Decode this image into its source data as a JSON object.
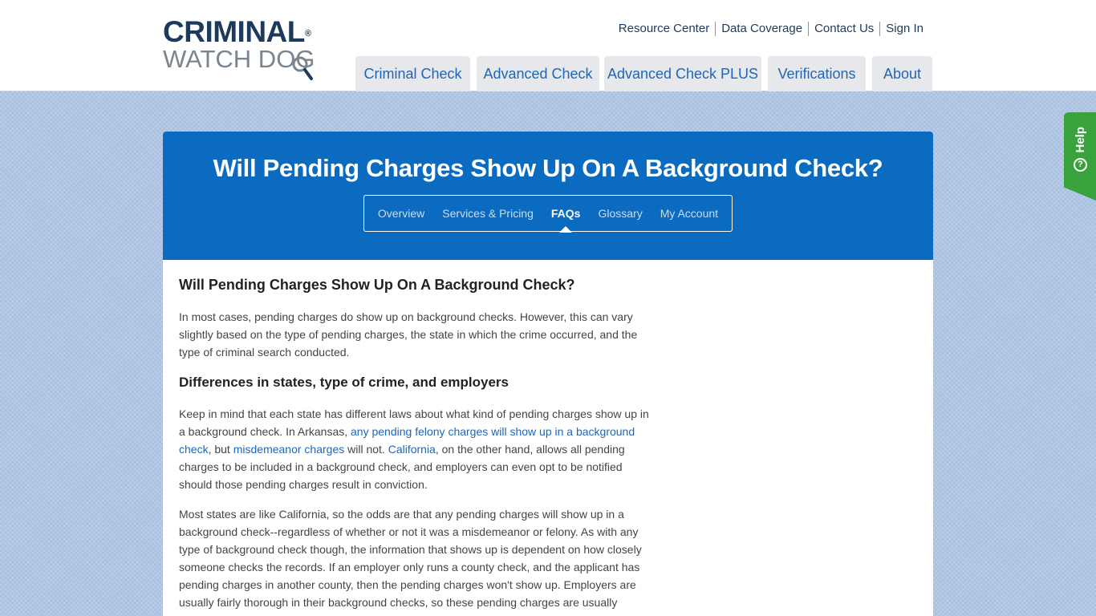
{
  "logo": {
    "line1": "CRIMINAL",
    "registered": "®",
    "line2": "WATCH DOG"
  },
  "top_links": [
    "Resource Center",
    "Data Coverage",
    "Contact Us",
    "Sign In"
  ],
  "main_nav": [
    "Criminal Check",
    "Advanced Check",
    "Advanced Check PLUS",
    "Verifications",
    "About"
  ],
  "help": {
    "label": "Help",
    "icon": "question-circle-icon"
  },
  "banner": {
    "title": "Will Pending Charges Show Up On A Background Check?",
    "subnav": [
      "Overview",
      "Services & Pricing",
      "FAQs",
      "Glossary",
      "My Account"
    ],
    "active_subnav": "FAQs"
  },
  "article": {
    "heading": "Will Pending Charges Show Up On A Background Check?",
    "intro": "In most cases, pending charges do show up on background checks. However, this can vary slightly based on the type of pending charges, the state in which the crime occurred, and the type of criminal search conducted.",
    "subheading": "Differences in states, type of crime, and employers",
    "p2_a": "Keep in mind that each state has different laws about what kind of pending charges show up in a background check. In Arkansas, ",
    "p2_link1": "any pending felony charges will show up in a background check",
    "p2_b": ", but ",
    "p2_link2": "misdemeanor charges",
    "p2_c": " will not. ",
    "p2_link3": "California",
    "p2_d": ", on the other hand, allows all pending charges to be included in a background check, and employers can even opt to be notified should those pending charges result in conviction.",
    "p3": "Most states are like California, so the odds are that any pending charges will show up in a background check--regardless of whether or not it was a misdemeanor or felony. As with any type of background check though, the information that shows up is dependent on how closely someone checks the records. If an employer only runs a county check, and the applicant has pending charges in another county, then the pending charges won't show up. Employers are usually fairly thorough in their background checks, so these pending charges are usually"
  },
  "colors": {
    "brand_navy": "#1d3a5c",
    "link_blue": "#1f67b6",
    "banner_blue": "#0b6bc0",
    "help_green": "#3aa23c"
  }
}
